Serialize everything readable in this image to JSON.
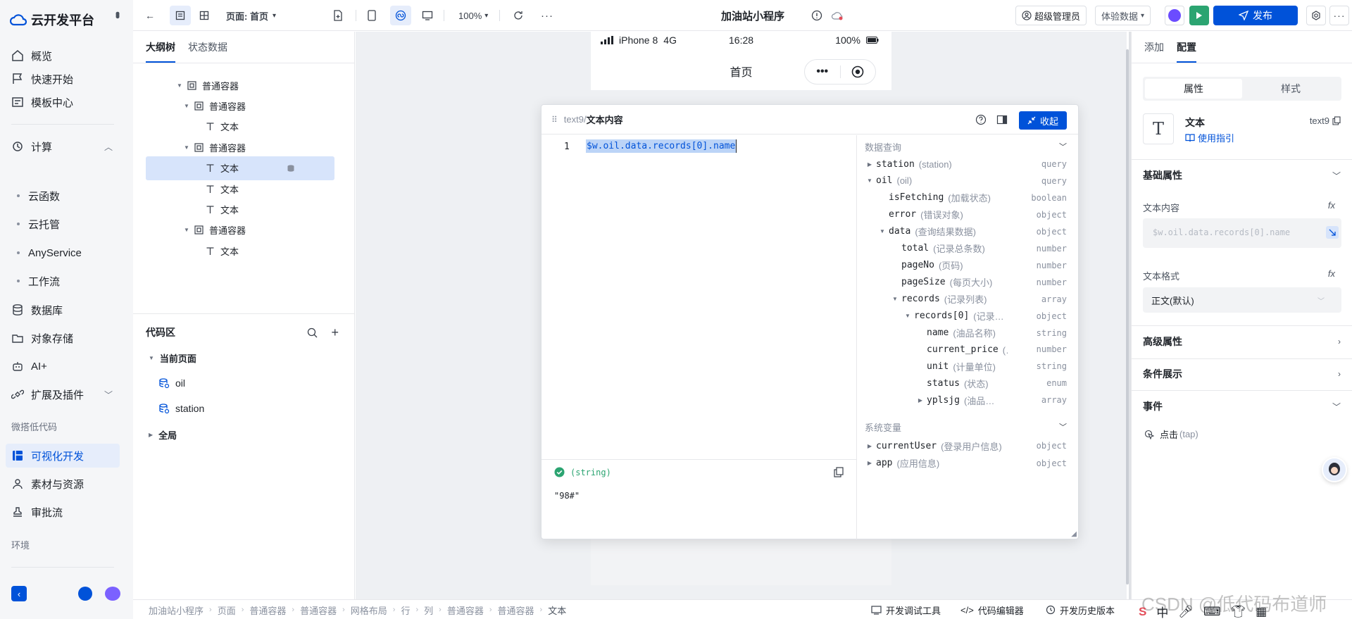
{
  "nav": {
    "brand": "云开发平台",
    "items": [
      {
        "label": "概览",
        "icon": "home-icon"
      },
      {
        "label": "快速开始",
        "icon": "flag-icon"
      },
      {
        "label": "模板中心",
        "icon": "template-icon"
      }
    ],
    "compute": {
      "label": "计算",
      "subs": [
        "云函数",
        "云托管",
        "AnyService",
        "工作流"
      ]
    },
    "items2": [
      {
        "label": "数据库",
        "icon": "database-icon"
      },
      {
        "label": "对象存储",
        "icon": "storage-icon"
      },
      {
        "label": "AI+",
        "icon": "robot-icon"
      },
      {
        "label": "扩展及插件",
        "icon": "plugin-icon"
      }
    ],
    "group_lowcode": "微搭低代码",
    "items3": [
      {
        "label": "可视化开发",
        "icon": "visual-icon",
        "active": true
      },
      {
        "label": "素材与资源",
        "icon": "assets-icon"
      },
      {
        "label": "审批流",
        "icon": "approval-icon"
      }
    ],
    "group_env": "环境",
    "accent": "#0052d9"
  },
  "toolbar": {
    "page_label": "页面: 首页",
    "zoom": "100%",
    "app_title": "加油站小程序",
    "user": "超级管理员",
    "data_mode": "体验数据",
    "publish": "发布"
  },
  "left": {
    "tabs": [
      "大纲树",
      "状态数据"
    ],
    "tree": [
      {
        "label": "普通容器",
        "type": "container",
        "indent": 1,
        "arrow": true
      },
      {
        "label": "普通容器",
        "type": "container",
        "indent": 2,
        "arrow": true
      },
      {
        "label": "文本",
        "type": "text",
        "indent": 3
      },
      {
        "label": "普通容器",
        "type": "container",
        "indent": 2,
        "arrow": true
      },
      {
        "label": "文本",
        "type": "text",
        "indent": 3,
        "selected": true
      },
      {
        "label": "文本",
        "type": "text",
        "indent": 3
      },
      {
        "label": "文本",
        "type": "text",
        "indent": 3
      },
      {
        "label": "普通容器",
        "type": "container",
        "indent": 2,
        "arrow": true
      },
      {
        "label": "文本",
        "type": "text",
        "indent": 3
      }
    ],
    "code_title": "代码区",
    "current_page": "当前页面",
    "queries": [
      "oil",
      "station"
    ],
    "global": "全局"
  },
  "phone": {
    "carrier": "iPhone 8",
    "network": "4G",
    "time": "16:28",
    "battery": "100%",
    "page_title": "首页"
  },
  "editor": {
    "id": "text9",
    "title": "文本内容",
    "collapse": "收起",
    "line_no": "1",
    "expression": "$w.oil.data.records[0].name",
    "result_type": "(string)",
    "result_value": "\"98#\"",
    "section_query": "数据查询",
    "section_sys": "系统变量",
    "rows": [
      {
        "name": "station",
        "desc": "(station)",
        "type": "query",
        "indent": 0,
        "arrow": "right"
      },
      {
        "name": "oil",
        "desc": "(oil)",
        "type": "query",
        "indent": 0,
        "arrow": "down"
      },
      {
        "name": "isFetching",
        "desc": "(加载状态)",
        "type": "boolean",
        "indent": 1
      },
      {
        "name": "error",
        "desc": "(错误对象)",
        "type": "object",
        "indent": 1
      },
      {
        "name": "data",
        "desc": "(查询结果数据)",
        "type": "object",
        "indent": 1,
        "arrow": "down"
      },
      {
        "name": "total",
        "desc": "(记录总条数)",
        "type": "number",
        "indent": 2
      },
      {
        "name": "pageNo",
        "desc": "(页码)",
        "type": "number",
        "indent": 2
      },
      {
        "name": "pageSize",
        "desc": "(每页大小)",
        "type": "number",
        "indent": 2
      },
      {
        "name": "records",
        "desc": "(记录列表)",
        "type": "array",
        "indent": 2,
        "arrow": "down"
      },
      {
        "name": "records[0]",
        "desc": "(记录列…",
        "type": "object",
        "indent": 3,
        "arrow": "down"
      },
      {
        "name": "name",
        "desc": "(油品名称)",
        "type": "string",
        "indent": 4
      },
      {
        "name": "current_price",
        "desc": "(当…",
        "type": "number",
        "indent": 4
      },
      {
        "name": "unit",
        "desc": "(计量单位)",
        "type": "string",
        "indent": 4
      },
      {
        "name": "status",
        "desc": "(状态)",
        "type": "enum",
        "indent": 4
      },
      {
        "name": "yplsjg",
        "desc": "(油品历史价…",
        "type": "array",
        "indent": 4,
        "arrow": "right"
      }
    ],
    "sys_rows": [
      {
        "name": "currentUser",
        "desc": "(登录用户信息)",
        "type": "object"
      },
      {
        "name": "app",
        "desc": "(应用信息)",
        "type": "object"
      }
    ]
  },
  "right": {
    "tabs": [
      "添加",
      "配置"
    ],
    "subtabs": [
      "属性",
      "样式"
    ],
    "component_name": "文本",
    "component_guide": "使用指引",
    "component_id": "text9",
    "basic": "基础属性",
    "text_content_label": "文本内容",
    "text_content_value": "$w.oil.data.records[0].name",
    "text_format_label": "文本格式",
    "text_format_value": "正文(默认)",
    "advanced": "高级属性",
    "condition": "条件展示",
    "events": "事件",
    "event_item": "点击",
    "event_tap": "(tap)"
  },
  "bottom": {
    "crumbs": [
      "加油站小程序",
      "页面",
      "普通容器",
      "普通容器",
      "网格布局",
      "行",
      "列",
      "普通容器",
      "普通容器",
      "文本"
    ],
    "tools": [
      "开发调试工具",
      "代码编辑器",
      "开发历史版本"
    ],
    "watermark": "CSDN @低代码布道师",
    "ime": "中"
  }
}
